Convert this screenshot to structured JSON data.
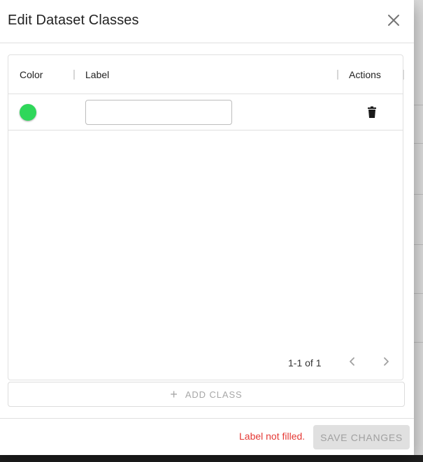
{
  "dialog": {
    "title": "Edit Dataset Classes",
    "close_icon": "close-icon"
  },
  "table": {
    "columns": [
      "Color",
      "Label",
      "Actions"
    ],
    "rows": [
      {
        "color": "#2fd75a",
        "label_value": "",
        "action_icon": "trash-icon"
      }
    ],
    "pagination": {
      "info": "1-1 of 1",
      "prev_icon": "chevron-left-icon",
      "next_icon": "chevron-right-icon"
    }
  },
  "add_class": {
    "icon": "plus-icon",
    "label": "ADD CLASS"
  },
  "footer": {
    "error": "Label not filled.",
    "save_label": "SAVE CHANGES"
  },
  "colors": {
    "error": "#e53935",
    "disabled_bg": "#e0e0e0",
    "disabled_text": "#a0a0a0"
  }
}
